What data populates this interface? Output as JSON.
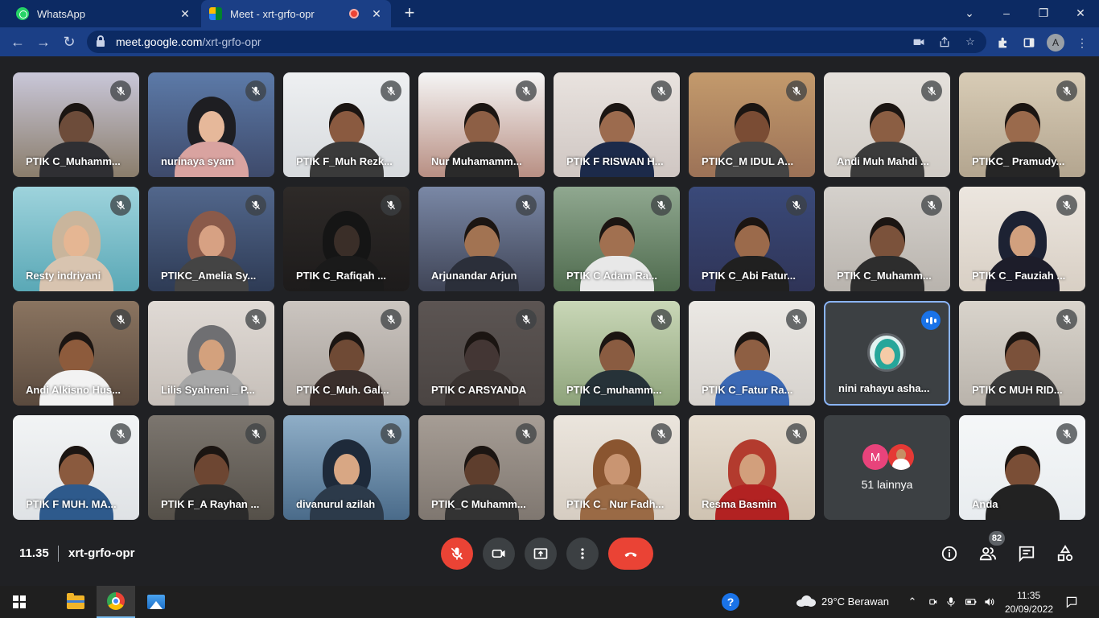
{
  "browser": {
    "tabs": [
      {
        "title": "WhatsApp",
        "close": "✕",
        "favicon": "whatsapp-icon"
      },
      {
        "title": "Meet - xrt-grfo-opr",
        "close": "✕",
        "favicon": "google-meet-icon",
        "recording": true
      }
    ],
    "new_tab": "+",
    "window_controls": {
      "list": "⌄",
      "minimize": "–",
      "restore": "❐",
      "close": "✕"
    },
    "url_host": "meet.google.com",
    "url_path": "/xrt-grfo-opr",
    "profile_initial": "A"
  },
  "meet": {
    "tiles": [
      {
        "name": "PTIK C_Muhamm...",
        "muted": true,
        "bg": "#8a7d6b",
        "top": "#c9c7d9",
        "skin": "#6d4c3a",
        "shirt": "#2f2f33",
        "type": "male"
      },
      {
        "name": "nurinaya syam",
        "muted": true,
        "bg": "#3e4a6b",
        "top": "#5c7aa8",
        "skin": "#e6b89a",
        "shirt": "#d9a3a0",
        "type": "hijab",
        "hijab": "#1e1e22"
      },
      {
        "name": "PTIK F_Muh Rezk...",
        "muted": true,
        "bg": "#d7dadd",
        "top": "#eef0f2",
        "skin": "#8a5a40",
        "shirt": "#3a3a3a",
        "type": "male"
      },
      {
        "name": "Nur Muhamamm...",
        "muted": true,
        "bg": "#b88f83",
        "top": "#f5f5f5",
        "skin": "#8d5f45",
        "shirt": "#2a2a2a",
        "type": "male"
      },
      {
        "name": "PTIK F RISWAN H...",
        "muted": true,
        "bg": "#cfc6c2",
        "top": "#e9e3df",
        "skin": "#9c6b4e",
        "shirt": "#1c2a4a",
        "type": "male"
      },
      {
        "name": "PTIKC_M IDUL A...",
        "muted": true,
        "bg": "#9c7257",
        "top": "#c39a6c",
        "skin": "#7a4c34",
        "shirt": "#444444",
        "type": "male"
      },
      {
        "name": "Andi Muh Mahdi ...",
        "muted": true,
        "bg": "#d0cbc5",
        "top": "#e5e1dc",
        "skin": "#8b5e43",
        "shirt": "#3b3b3b",
        "type": "male"
      },
      {
        "name": "PTIKC_ Pramudy...",
        "muted": true,
        "bg": "#b3a58f",
        "top": "#d8ccb6",
        "skin": "#9a6a4c",
        "shirt": "#262626",
        "type": "male"
      },
      {
        "name": "Resty indriyani",
        "muted": true,
        "bg": "#5aa8b6",
        "top": "#9ed3dc",
        "skin": "#e5b693",
        "shirt": "#d8c4b0",
        "type": "hijab",
        "hijab": "#c9b59c"
      },
      {
        "name": "PTIKC_Amelia Sy...",
        "muted": true,
        "bg": "#2e3b55",
        "top": "#52678c",
        "skin": "#d7a183",
        "shirt": "#444",
        "type": "hijab",
        "hijab": "#8a5a4a"
      },
      {
        "name": "PTIK C_Rafiqah ...",
        "muted": true,
        "bg": "#1d1b1b",
        "top": "#2e2a28",
        "skin": "#3a2e28",
        "shirt": "#1a1a1a",
        "type": "hijab",
        "hijab": "#151515"
      },
      {
        "name": "Arjunandar Arjun",
        "muted": true,
        "bg": "#3f4456",
        "top": "#7a88a6",
        "skin": "#a27352",
        "shirt": "#2b2f3a",
        "type": "male"
      },
      {
        "name": "PTIK C Adam Ra...",
        "muted": true,
        "bg": "#4f6b4e",
        "top": "#90a890",
        "skin": "#a17050",
        "shirt": "#e8e8e8",
        "type": "male"
      },
      {
        "name": "PTIK C_Abi Fatur...",
        "muted": true,
        "bg": "#2f3457",
        "top": "#3a4a7a",
        "skin": "#9b6a4b",
        "shirt": "#202020",
        "type": "male"
      },
      {
        "name": "PTIK C_Muhamm...",
        "muted": true,
        "bg": "#b8b3ad",
        "top": "#d5d1cc",
        "skin": "#7b523b",
        "shirt": "#2d2d2d",
        "type": "male"
      },
      {
        "name": "PTIK C_ Fauziah ...",
        "muted": true,
        "bg": "#d8cfc4",
        "top": "#ece6df",
        "skin": "#d1a07e",
        "shirt": "#1d1d2a",
        "type": "hijab",
        "hijab": "#1d2233"
      },
      {
        "name": "Andi Alkisno Hus...",
        "muted": true,
        "bg": "#5a4a3e",
        "top": "#8a7460",
        "skin": "#8d5b3c",
        "shirt": "#f2f2f2",
        "type": "male"
      },
      {
        "name": "Lilis Syahreni _ P...",
        "muted": true,
        "bg": "#c6bfb9",
        "top": "#e0dad5",
        "skin": "#d3a17d",
        "shirt": "#a7a7a7",
        "type": "hijab",
        "hijab": "#6f6f72"
      },
      {
        "name": "PTIK C_Muh. Gal...",
        "muted": true,
        "bg": "#a7a09a",
        "top": "#cbc5c0",
        "skin": "#6f4a35",
        "shirt": "#3a2f2c",
        "type": "male"
      },
      {
        "name": "PTIK C ARSYANDA",
        "muted": true,
        "bg": "#4a4442",
        "top": "#5c5553",
        "skin": "#433634",
        "shirt": "#3a3331",
        "type": "male"
      },
      {
        "name": "PTIK C_muhamm...",
        "muted": true,
        "bg": "#8ea37b",
        "top": "#c9d7b7",
        "skin": "#8a5c41",
        "shirt": "#263238",
        "type": "male"
      },
      {
        "name": "PTIK C_Fatur Ra...",
        "muted": true,
        "bg": "#d6d2cd",
        "top": "#ebe8e4",
        "skin": "#8e5f43",
        "shirt": "#3b69b5",
        "type": "male"
      },
      {
        "name": "nini rahayu asha...",
        "muted": false,
        "speaking": true
      },
      {
        "name": "PTIK C MUH RID...",
        "muted": true,
        "bg": "#b9b3ab",
        "top": "#d9d4cc",
        "skin": "#7b513a",
        "shirt": "#3a3a3a",
        "type": "male"
      },
      {
        "name": "PTIK F MUH. MA...",
        "muted": true,
        "bg": "#dfe2e5",
        "top": "#f2f4f5",
        "skin": "#8a5a3e",
        "shirt": "#2e5a8c",
        "type": "male"
      },
      {
        "name": "PTIK F_A Rayhan ...",
        "muted": true,
        "bg": "#555049",
        "top": "#7c766f",
        "skin": "#6d4632",
        "shirt": "#2a2a2a",
        "type": "male"
      },
      {
        "name": "divanurul azilah",
        "muted": true,
        "bg": "#4a6b8a",
        "top": "#8faec7",
        "skin": "#d8a784",
        "shirt": "#2c3a4a",
        "type": "hijab",
        "hijab": "#1e2a3a"
      },
      {
        "name": "PTIK_C Muhamm...",
        "muted": true,
        "bg": "#7f7770",
        "top": "#a69d95",
        "skin": "#5e3e2d",
        "shirt": "#333",
        "type": "male"
      },
      {
        "name": "PTIK C_ Nur Fadh...",
        "muted": true,
        "bg": "#d6cdc2",
        "top": "#ebe5dd",
        "skin": "#c99572",
        "shirt": "#9a6a45",
        "type": "hijab",
        "hijab": "#8a5530"
      },
      {
        "name": "Resma Basmin",
        "muted": true,
        "bg": "#cfc3b2",
        "top": "#e6ddd0",
        "skin": "#d29f7c",
        "shirt": "#b22222",
        "type": "hijab",
        "hijab": "#b33b2e"
      },
      {
        "others": true,
        "avatar_letter": "M",
        "text": "51 lainnya"
      },
      {
        "name": "Anda",
        "muted": true,
        "bg": "#e8ecef",
        "top": "#f5f7f8",
        "skin": "#7a4e36",
        "shirt": "#222222",
        "type": "male",
        "self": true
      }
    ],
    "time": "11.35",
    "code": "xrt-grfo-opr",
    "participant_count": "82"
  },
  "taskbar": {
    "weather": "29°C  Berawan",
    "clock_time": "11:35",
    "clock_date": "20/09/2022"
  }
}
